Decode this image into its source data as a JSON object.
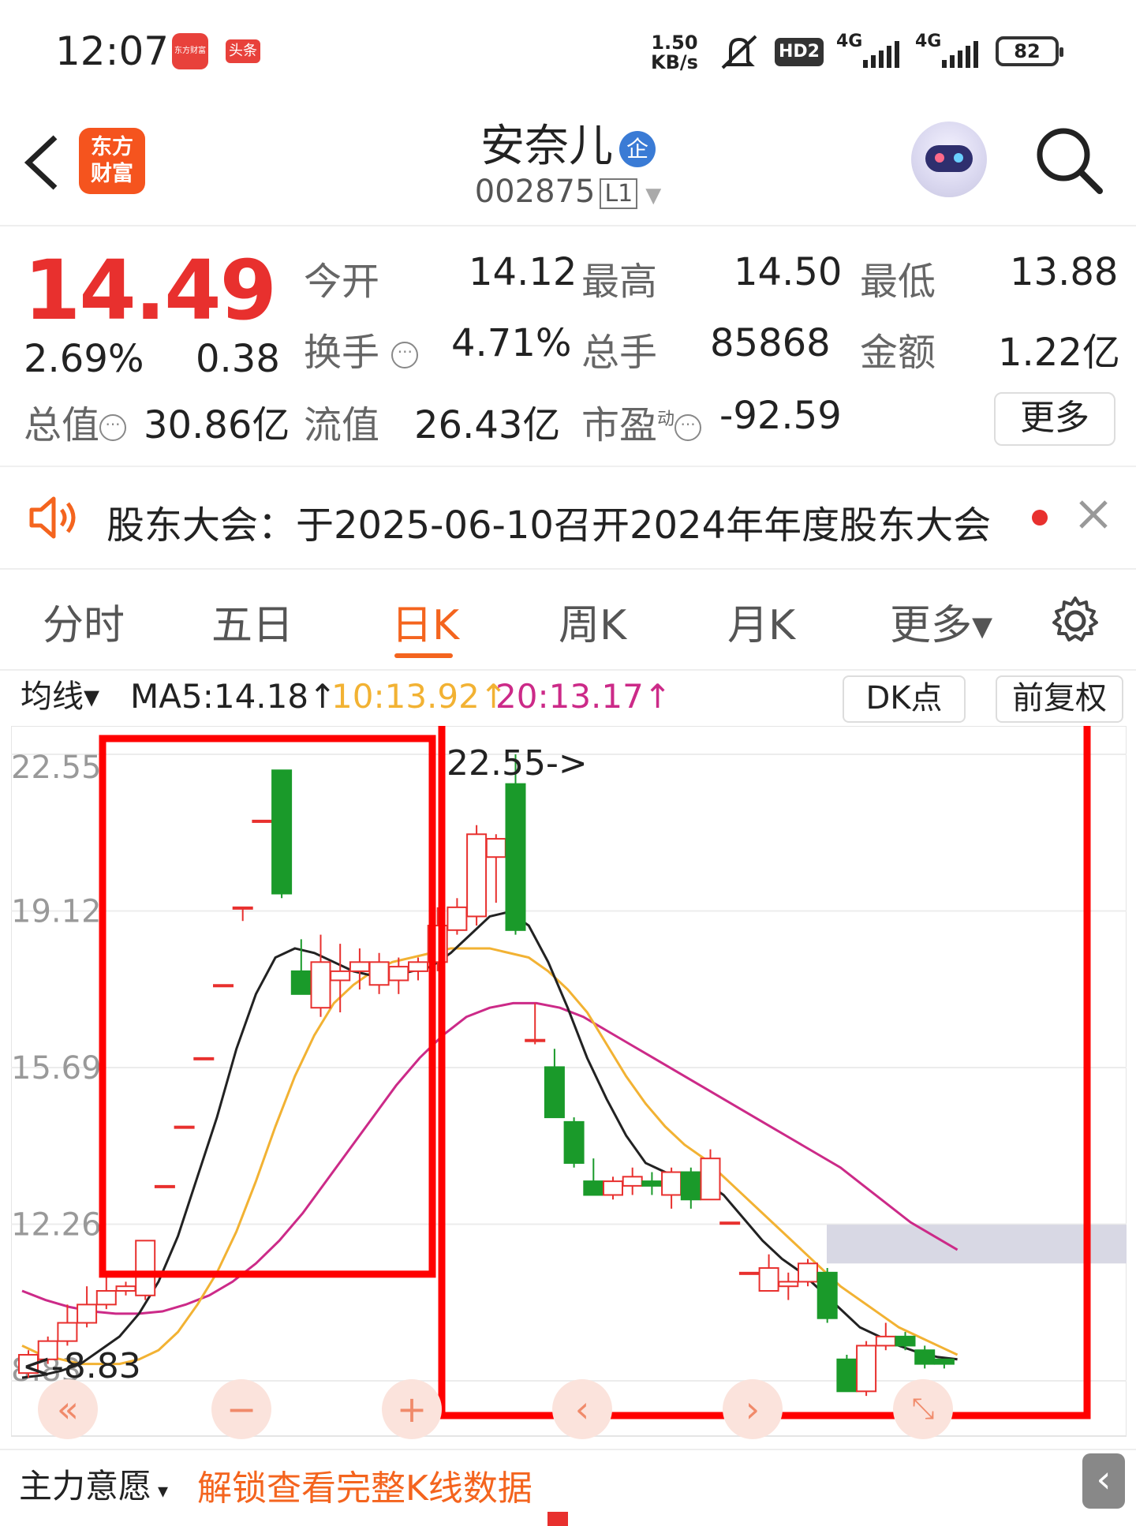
{
  "status_bar": {
    "time": "12:07",
    "app_icon_1": "东方财富",
    "app_icon_2": "头条",
    "net_speed_value": "1.50",
    "net_speed_unit": "KB/s",
    "hd": "HD2",
    "signal_1": "4G",
    "signal_2": "4G",
    "battery": "82"
  },
  "header": {
    "back_icon": "chevron-left-icon",
    "logo_line1": "东方",
    "logo_line2": "财富",
    "stock_name": "安奈儿",
    "enterprise_badge": "企",
    "stock_code": "002875",
    "market_badge": "L1",
    "search_icon": "search-icon",
    "assistant_icon": "robot-avatar-icon"
  },
  "quote": {
    "price": "14.49",
    "change_pct": "2.69%",
    "change_amt": "0.38",
    "open_label": "今开",
    "open": "14.12",
    "high_label": "最高",
    "high": "14.50",
    "low_label": "最低",
    "low": "13.88",
    "turnover_label": "换手",
    "turnover": "4.71%",
    "volume_label": "总手",
    "volume": "85868",
    "amount_label": "金额",
    "amount": "1.22亿",
    "total_value_label": "总值",
    "total_value": "30.86亿",
    "float_value_label": "流值",
    "float_value": "26.43亿",
    "pe_label": "市盈",
    "pe_sup": "动",
    "pe": "-92.59",
    "more": "更多"
  },
  "notice": {
    "text": "股东大会：于2025-06-10召开2024年年度股东大会",
    "close_icon": "close-icon",
    "speaker_icon": "speaker-icon"
  },
  "tabs": [
    {
      "label": "分时"
    },
    {
      "label": "五日"
    },
    {
      "label": "日K",
      "active": true
    },
    {
      "label": "周K"
    },
    {
      "label": "月K"
    },
    {
      "label": "更多▾"
    }
  ],
  "indicator": {
    "selector": "均线▾",
    "ma5": "MA5:14.18↑",
    "ma10": "10:13.92↑",
    "ma20": "20:13.17↑",
    "dk": "DK点",
    "adjust": "前复权"
  },
  "colors": {
    "up": "#e8302e",
    "down": "#1a9a2a",
    "ma5": "#222222",
    "ma10": "#f2b233",
    "ma20": "#cc2a88",
    "accent": "#f4641e",
    "annotation": "#ff0000"
  },
  "chart_data": {
    "type": "candlestick",
    "y_ticks": [
      "22.55",
      "19.12",
      "15.69",
      "12.26",
      "8.83"
    ],
    "ylim": [
      8.83,
      22.55
    ],
    "max_annotation": "22.55->",
    "min_annotation": "<-8.83",
    "candles": [
      {
        "o": 9.0,
        "c": 9.4,
        "h": 9.5,
        "l": 8.9
      },
      {
        "o": 9.3,
        "c": 9.7,
        "h": 9.8,
        "l": 9.2
      },
      {
        "o": 9.7,
        "c": 10.1,
        "h": 10.5,
        "l": 9.6
      },
      {
        "o": 10.1,
        "c": 10.5,
        "h": 10.9,
        "l": 10.0
      },
      {
        "o": 10.5,
        "c": 10.8,
        "h": 11.1,
        "l": 10.4
      },
      {
        "o": 10.8,
        "c": 10.9,
        "h": 11.0,
        "l": 10.7
      },
      {
        "o": 10.7,
        "c": 11.9,
        "h": 11.9,
        "l": 10.6
      },
      {
        "o": 13.1,
        "c": 13.1,
        "h": 13.1,
        "l": 13.1
      },
      {
        "o": 14.4,
        "c": 14.4,
        "h": 14.4,
        "l": 14.4
      },
      {
        "o": 15.9,
        "c": 15.9,
        "h": 15.9,
        "l": 15.9
      },
      {
        "o": 17.5,
        "c": 17.5,
        "h": 17.5,
        "l": 17.5
      },
      {
        "o": 19.2,
        "c": 19.2,
        "h": 19.2,
        "l": 18.9
      },
      {
        "o": 21.1,
        "c": 21.1,
        "h": 21.1,
        "l": 21.1
      },
      {
        "o": 22.2,
        "c": 19.5,
        "h": 22.2,
        "l": 19.4
      },
      {
        "o": 17.8,
        "c": 17.3,
        "h": 18.5,
        "l": 17.3
      },
      {
        "o": 17.0,
        "c": 18.0,
        "h": 18.6,
        "l": 16.8
      },
      {
        "o": 17.6,
        "c": 17.8,
        "h": 18.4,
        "l": 16.9
      },
      {
        "o": 17.8,
        "c": 18.0,
        "h": 18.3,
        "l": 17.4
      },
      {
        "o": 17.5,
        "c": 18.0,
        "h": 18.2,
        "l": 17.3
      },
      {
        "o": 17.6,
        "c": 17.9,
        "h": 18.1,
        "l": 17.3
      },
      {
        "o": 17.8,
        "c": 18.0,
        "h": 18.1,
        "l": 17.6
      },
      {
        "o": 18.0,
        "c": 18.8,
        "h": 19.2,
        "l": 17.8
      },
      {
        "o": 18.7,
        "c": 19.2,
        "h": 19.4,
        "l": 18.6
      },
      {
        "o": 19.0,
        "c": 20.8,
        "h": 21.0,
        "l": 18.8
      },
      {
        "o": 20.3,
        "c": 20.7,
        "h": 20.8,
        "l": 19.3
      },
      {
        "o": 21.9,
        "c": 18.7,
        "h": 22.55,
        "l": 18.6
      },
      {
        "o": 16.3,
        "c": 16.3,
        "h": 17.1,
        "l": 16.2
      },
      {
        "o": 15.7,
        "c": 14.6,
        "h": 16.1,
        "l": 14.6
      },
      {
        "o": 14.5,
        "c": 13.6,
        "h": 14.6,
        "l": 13.5
      },
      {
        "o": 13.2,
        "c": 12.9,
        "h": 13.7,
        "l": 12.9
      },
      {
        "o": 12.9,
        "c": 13.2,
        "h": 13.3,
        "l": 12.8
      },
      {
        "o": 13.1,
        "c": 13.3,
        "h": 13.5,
        "l": 12.9
      },
      {
        "o": 13.2,
        "c": 13.1,
        "h": 13.4,
        "l": 12.9
      },
      {
        "o": 12.9,
        "c": 13.4,
        "h": 13.5,
        "l": 12.6
      },
      {
        "o": 13.4,
        "c": 12.8,
        "h": 13.5,
        "l": 12.6
      },
      {
        "o": 12.8,
        "c": 13.7,
        "h": 13.9,
        "l": 12.8
      },
      {
        "o": 12.3,
        "c": 12.3,
        "h": 12.3,
        "l": 12.3
      },
      {
        "o": 11.2,
        "c": 11.2,
        "h": 11.2,
        "l": 11.2
      },
      {
        "o": 10.8,
        "c": 11.3,
        "h": 11.6,
        "l": 10.8
      },
      {
        "o": 10.9,
        "c": 11.0,
        "h": 11.2,
        "l": 10.6
      },
      {
        "o": 11.0,
        "c": 11.4,
        "h": 11.5,
        "l": 10.9
      },
      {
        "o": 11.2,
        "c": 10.2,
        "h": 11.3,
        "l": 10.1
      },
      {
        "o": 9.3,
        "c": 8.6,
        "h": 9.4,
        "l": 8.6
      },
      {
        "o": 8.6,
        "c": 9.6,
        "h": 9.7,
        "l": 8.5
      },
      {
        "o": 9.6,
        "c": 9.8,
        "h": 10.1,
        "l": 9.5
      },
      {
        "o": 9.8,
        "c": 9.6,
        "h": 9.9,
        "l": 9.5
      },
      {
        "o": 9.5,
        "c": 9.2,
        "h": 9.6,
        "l": 9.1
      },
      {
        "o": 9.3,
        "c": 9.2,
        "h": 9.3,
        "l": 9.1
      }
    ],
    "ma5": [
      8.9,
      8.95,
      9.05,
      9.2,
      9.5,
      9.8,
      10.3,
      11.0,
      12.0,
      13.3,
      14.6,
      16.1,
      17.3,
      18.1,
      18.3,
      18.2,
      18.0,
      17.8,
      17.7,
      17.7,
      17.8,
      17.9,
      18.2,
      18.6,
      19.0,
      19.1,
      18.8,
      18.0,
      17.0,
      15.9,
      15.0,
      14.2,
      13.6,
      13.4,
      13.3,
      13.2,
      12.9,
      12.4,
      11.9,
      11.5,
      11.2,
      10.8,
      10.4,
      10.0,
      9.8,
      9.6,
      9.45,
      9.35,
      9.3
    ],
    "ma10": [
      9.6,
      9.4,
      9.3,
      9.2,
      9.2,
      9.2,
      9.3,
      9.5,
      9.9,
      10.5,
      11.2,
      12.1,
      13.2,
      14.4,
      15.5,
      16.4,
      17.1,
      17.5,
      17.8,
      18.0,
      18.1,
      18.2,
      18.3,
      18.3,
      18.3,
      18.2,
      18.1,
      17.8,
      17.4,
      16.9,
      16.2,
      15.5,
      14.9,
      14.4,
      14.0,
      13.7,
      13.3,
      12.9,
      12.5,
      12.1,
      11.7,
      11.3,
      10.9,
      10.6,
      10.3,
      10.0,
      9.8,
      9.6,
      9.4
    ],
    "ma20": [
      10.8,
      10.6,
      10.45,
      10.35,
      10.3,
      10.3,
      10.35,
      10.5,
      10.7,
      11.0,
      11.4,
      11.9,
      12.5,
      13.2,
      13.9,
      14.6,
      15.3,
      15.9,
      16.4,
      16.8,
      17.0,
      17.1,
      17.1,
      17.0,
      16.8,
      16.5,
      16.2,
      15.9,
      15.6,
      15.3,
      15.0,
      14.7,
      14.4,
      14.1,
      13.8,
      13.5,
      13.1,
      12.7,
      12.3,
      12.0,
      11.7
    ]
  },
  "controls": {
    "zoom_out": "−",
    "zoom_in": "+",
    "prev": "‹",
    "next": "›",
    "fullscreen": "⤡"
  },
  "footer": {
    "selector": "主力意愿",
    "selector_arrow": "▾",
    "unlock": "解锁查看完整K线数据",
    "side_btn": "‹"
  }
}
